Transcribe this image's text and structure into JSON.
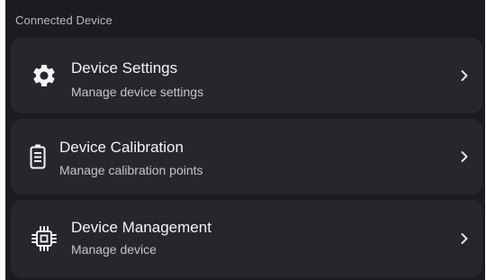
{
  "section": {
    "title": "Connected Device"
  },
  "items": [
    {
      "title": "Device Settings",
      "subtitle": "Manage device settings",
      "icon": "gear-icon"
    },
    {
      "title": "Device Calibration",
      "subtitle": "Manage calibration points",
      "icon": "battery-icon"
    },
    {
      "title": "Device Management",
      "subtitle": "Manage device",
      "icon": "chip-icon"
    }
  ],
  "colors": {
    "background": "#1a1c20",
    "card": "#25272c",
    "title_text": "#f2f3f5",
    "subtitle_text": "#c3c5c9",
    "section_text": "#b7b9bd"
  }
}
